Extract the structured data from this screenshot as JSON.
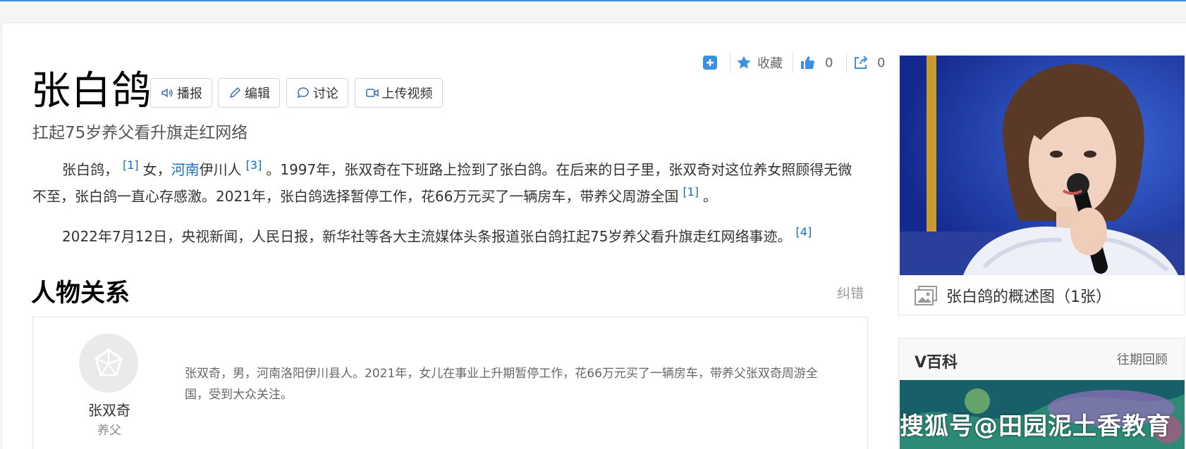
{
  "entry": {
    "title": "张白鸽",
    "subtitle": "扛起75岁养父看升旗走红网络",
    "buttons": {
      "broadcast": "播报",
      "edit": "编辑",
      "discuss": "讨论",
      "upload_video": "上传视频"
    }
  },
  "toolbar": {
    "collect_label": "收藏",
    "like_count": "0",
    "share_count": "0"
  },
  "summary": {
    "p1_part1": "张白鸽，",
    "ref1": "[1]",
    "p1_part2": "女，",
    "p1_link": "河南",
    "p1_part3": "伊川人",
    "ref3": "[3]",
    "p1_part4": "。1997年，张双奇在下班路上捡到了张白鸽。在后来的日子里，张双奇对这位养女照顾得无微不至，张白鸽一直心存感激。2021年，张白鸽选择暂停工作，花66万元买了一辆房车，带养父周游全国",
    "ref1b": "[1]",
    "p1_end": "。",
    "p2_text": "2022年7月12日，央视新闻，人民日报，新华社等各大主流媒体头条报道张白鸽扛起75岁养父看升旗走红网络事迹。",
    "ref4": "[4]"
  },
  "relations": {
    "section_title": "人物关系",
    "correct_label": "纠错",
    "person": {
      "name": "张双奇",
      "role": "养父",
      "description": "张双奇，男，河南洛阳伊川县人。2021年，女儿在事业上升期暂停工作，花66万元买了一辆房车，带养父张双奇周游全国，受到大众关注。"
    }
  },
  "sidebar": {
    "photo_caption": "张白鸽的概述图（1张）",
    "vbaike": {
      "title": "V百科",
      "more": "往期回顾",
      "watermark": "搜狐号@田园泥土香教育"
    }
  },
  "colors": {
    "accent": "#136ec2",
    "icon_blue": "#3d8fe0",
    "top_bar": "#3d8fe0"
  }
}
